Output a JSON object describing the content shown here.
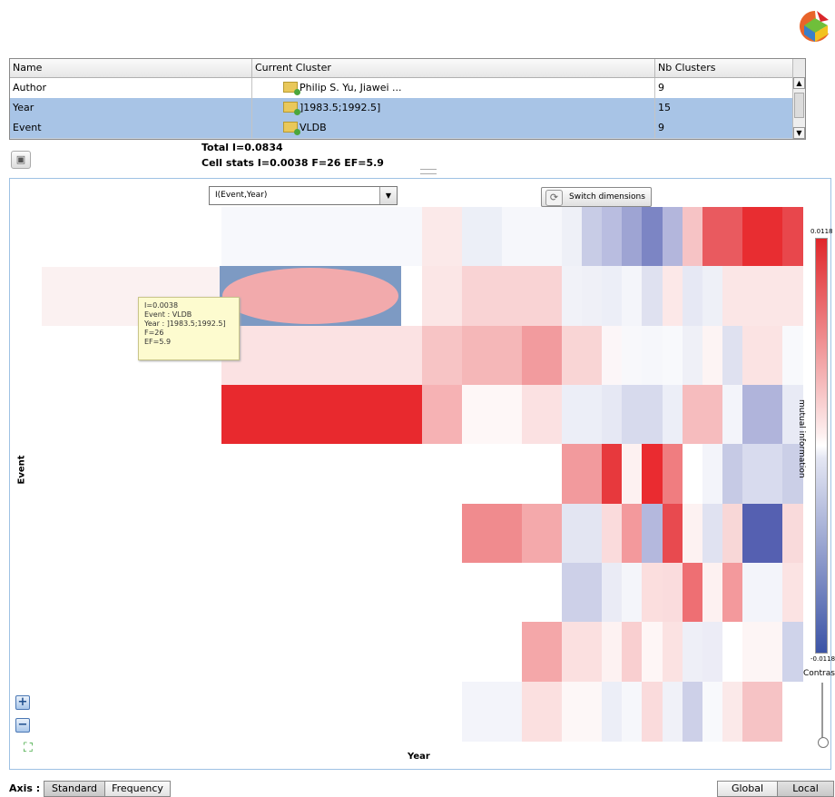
{
  "table": {
    "columns": [
      "Name",
      "Current Cluster",
      "Nb Clusters"
    ],
    "rows": [
      {
        "name": "Author",
        "cluster": "Philip S. Yu, Jiawei ...",
        "nb": "9",
        "selected": false
      },
      {
        "name": "Year",
        "cluster": "]1983.5;1992.5]",
        "nb": "15",
        "selected": true
      },
      {
        "name": "Event",
        "cluster": "VLDB",
        "nb": "9",
        "selected": true
      }
    ]
  },
  "stats": {
    "total": "Total I=0.0834",
    "cell": "Cell stats I=0.0038  F=26 EF=5.9"
  },
  "toolbar": {
    "dropdown_value": "I(Event,Year)",
    "switch_label": "Switch dimensions"
  },
  "tooltip": {
    "lines": [
      "I=0.0038",
      "Event : VLDB",
      "Year : ]1983.5;1992.5]",
      "F=26",
      "EF=5.9"
    ]
  },
  "axes": {
    "y_label": "Event",
    "x_label": "Year"
  },
  "colorbar": {
    "max": "0.0118",
    "min": "-0.0118",
    "title": "mutual information",
    "contrast_label": "Contrast"
  },
  "bottom": {
    "axis_label": "Axis :",
    "axis_buttons": [
      "Standard",
      "Frequency"
    ],
    "scope_buttons": [
      "Global",
      "Local"
    ]
  },
  "colors": {
    "accent": "#a8c4e6",
    "positive": "#e0262a",
    "negative": "#3c54a6"
  },
  "heatmap": {
    "rows": [
      [
        "#f7f8fc",
        "#f7f8fc",
        "#f7f8fc",
        "#f7f8fc",
        "#f7f8fc",
        "#f7f8fc",
        "#f7f8fc",
        "#f7f8fc",
        "#f7f8fc",
        "#f7f8fc",
        "#fbe9e9",
        "#fbe9e9",
        "#eceff7",
        "#eceff7",
        "#f6f7fb",
        "#f6f7fb",
        "#f6f7fb",
        "#eef0f7",
        "#c8cce6",
        "#b9bde0",
        "#9ea4d3",
        "#7c85c4",
        "#b3b6dc",
        "#f6c3c5",
        "#e95a5f",
        "#e95a5f",
        "#e82d31",
        "#e82d31",
        "#e8474c"
      ],
      [
        "#ffffff",
        "#ffffff",
        "#ffffff",
        "#ffffff",
        "#ffffff",
        "#ffffff",
        "#ffffff",
        "#ffffff",
        "#ffffff",
        "#ffffff",
        "#fbe6e6",
        "#fbe6e6",
        "#f9d3d4",
        "#f9d3d4",
        "#f9d3d4",
        "#f9d3d4",
        "#f9d3d4",
        "#f1f2f8",
        "#eff0f7",
        "#eceef7",
        "#f4f5fa",
        "#dfe1f0",
        "#fce8e8",
        "#e6e8f4",
        "#eef0f7",
        "#fbe6e6",
        "#fbe6e6",
        "#fbe6e6",
        "#fbe6e6"
      ],
      [
        "#fbe2e3",
        "#fbe2e3",
        "#fbe2e3",
        "#fbe2e3",
        "#fbe2e3",
        "#fbe2e3",
        "#fbe2e3",
        "#fbe2e3",
        "#fbe2e3",
        "#fbe2e3",
        "#f7c4c5",
        "#f7c4c5",
        "#f5b7b8",
        "#f5b7b8",
        "#f5b7b8",
        "#f29b9e",
        "#f29b9e",
        "#f9d5d5",
        "#f9d5d5",
        "#fcf6f8",
        "#f8f8fb",
        "#f6f7fb",
        "#f8f9fc",
        "#eff0f7",
        "#fdf4f4",
        "#dfe1f0",
        "#fbe3e3",
        "#fbe3e3",
        "#f8f9fc"
      ],
      [
        "#e8292e",
        "#e8292e",
        "#e8292e",
        "#e8292e",
        "#e8292e",
        "#e8292e",
        "#e8292e",
        "#e8292e",
        "#e8292e",
        "#e8292e",
        "#f6b2b4",
        "#f6b2b4",
        "#fef7f7",
        "#fef7f7",
        "#fef7f7",
        "#fbe1e2",
        "#fbe1e2",
        "#eceef7",
        "#eceef7",
        "#e6e8f4",
        "#d7daed",
        "#d7daed",
        "#eceef7",
        "#f6bcbe",
        "#f6bcbe",
        "#f3f4fa",
        "#b0b4db",
        "#b0b4db",
        "#e8eaf5"
      ],
      [
        "#ffffff",
        "#ffffff",
        "#ffffff",
        "#ffffff",
        "#ffffff",
        "#ffffff",
        "#ffffff",
        "#ffffff",
        "#ffffff",
        "#ffffff",
        "#ffffff",
        "#ffffff",
        "#ffffff",
        "#ffffff",
        "#ffffff",
        "#ffffff",
        "#ffffff",
        "#f29a9d",
        "#f29a9d",
        "#e7393d",
        "#fdf1f1",
        "#ea2b30",
        "#f07d80",
        "#ffffff",
        "#f3f4fa",
        "#c6cae5",
        "#d8dbee",
        "#d8dbee",
        "#cbcfe7"
      ],
      [
        "#ffffff",
        "#ffffff",
        "#ffffff",
        "#ffffff",
        "#ffffff",
        "#ffffff",
        "#ffffff",
        "#ffffff",
        "#ffffff",
        "#ffffff",
        "#ffffff",
        "#ffffff",
        "#f08b8e",
        "#f08b8e",
        "#f08b8e",
        "#f4a9ab",
        "#f4a9ab",
        "#e3e5f2",
        "#e3e5f2",
        "#fadbdc",
        "#f3999c",
        "#b4b8dd",
        "#e84a4f",
        "#fdf2f2",
        "#e0e2f1",
        "#f8d7d7",
        "#5560b1",
        "#5560b1",
        "#f9dadb"
      ],
      [
        "#ffffff",
        "#ffffff",
        "#ffffff",
        "#ffffff",
        "#ffffff",
        "#ffffff",
        "#ffffff",
        "#ffffff",
        "#ffffff",
        "#ffffff",
        "#ffffff",
        "#ffffff",
        "#ffffff",
        "#ffffff",
        "#ffffff",
        "#ffffff",
        "#ffffff",
        "#cdd0e8",
        "#cdd0e8",
        "#eaebf5",
        "#f4f5fa",
        "#fbdede",
        "#fadcdd",
        "#ee6f73",
        "#fdf1f1",
        "#f3999c",
        "#f3f4fa",
        "#f3f4fa",
        "#fbe3e3"
      ],
      [
        "#ffffff",
        "#ffffff",
        "#ffffff",
        "#ffffff",
        "#ffffff",
        "#ffffff",
        "#ffffff",
        "#ffffff",
        "#ffffff",
        "#ffffff",
        "#ffffff",
        "#ffffff",
        "#ffffff",
        "#ffffff",
        "#ffffff",
        "#f4a7a9",
        "#f4a7a9",
        "#fbe0e0",
        "#fbe0e0",
        "#fdf2f2",
        "#f9cfd0",
        "#fef6f6",
        "#fbe2e2",
        "#eeeff7",
        "#ececf6",
        "#ffffff",
        "#fdf5f5",
        "#fdf5f5",
        "#cfd3ea"
      ],
      [
        "#ffffff",
        "#ffffff",
        "#ffffff",
        "#ffffff",
        "#ffffff",
        "#ffffff",
        "#ffffff",
        "#ffffff",
        "#ffffff",
        "#ffffff",
        "#ffffff",
        "#ffffff",
        "#f3f4fa",
        "#f3f4fa",
        "#f3f4fa",
        "#fbe0e0",
        "#fbe0e0",
        "#fdf7f7",
        "#fdf7f7",
        "#eceef7",
        "#f6f7fb",
        "#fadbdc",
        "#f0f1f8",
        "#cdd0e8",
        "#f8f9fc",
        "#fbe9e9",
        "#f6c3c5",
        "#f6c3c5",
        "#ffffff"
      ]
    ]
  }
}
